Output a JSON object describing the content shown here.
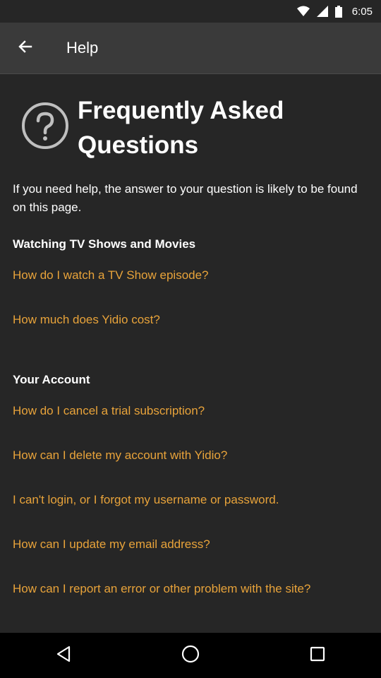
{
  "status": {
    "time": "6:05"
  },
  "app_bar": {
    "title": "Help"
  },
  "faq": {
    "title_line1": "Frequently Asked",
    "title_line2": "Questions",
    "intro": "If you need help, the answer to your question is likely to be found on this page."
  },
  "sections": [
    {
      "title": "Watching TV Shows and Movies",
      "links": [
        "How do I watch a TV Show episode?",
        "How much does Yidio cost?"
      ]
    },
    {
      "title": "Your Account",
      "links": [
        "How do I cancel a trial subscription?",
        "How can I delete my account with Yidio?",
        "I can't login, or I forgot my username or password.",
        "How can I update my email address?",
        "How can I report an error or other problem with the site?"
      ]
    }
  ],
  "colors": {
    "accent": "#e8a33a",
    "background": "#262626",
    "app_bar": "#3a3a3a"
  }
}
